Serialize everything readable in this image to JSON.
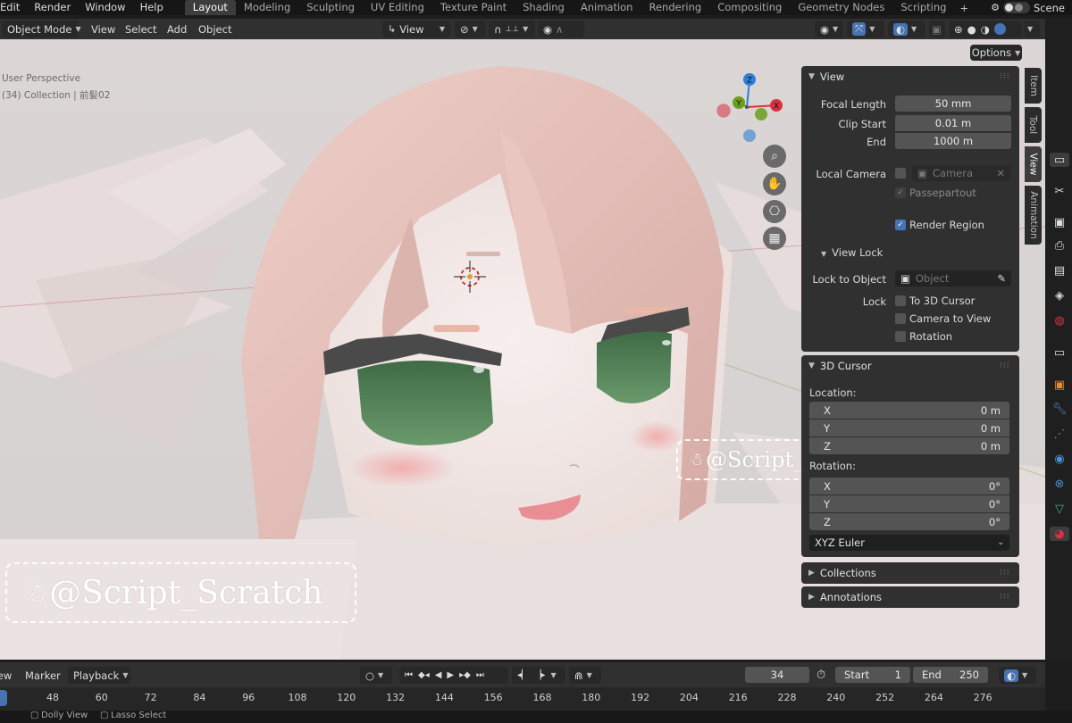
{
  "top_menu": [
    "Edit",
    "Render",
    "Window",
    "Help"
  ],
  "workspaces": [
    {
      "label": "Layout",
      "active": true
    },
    {
      "label": "Modeling",
      "active": false
    },
    {
      "label": "Sculpting",
      "active": false
    },
    {
      "label": "UV Editing",
      "active": false
    },
    {
      "label": "Texture Paint",
      "active": false
    },
    {
      "label": "Shading",
      "active": false
    },
    {
      "label": "Animation",
      "active": false
    },
    {
      "label": "Rendering",
      "active": false
    },
    {
      "label": "Compositing",
      "active": false
    },
    {
      "label": "Geometry Nodes",
      "active": false
    },
    {
      "label": "Scripting",
      "active": false
    }
  ],
  "add_workspace": "+",
  "scene_name": "Scene",
  "header": {
    "mode": "Object Mode",
    "menus": [
      "View",
      "Select",
      "Add",
      "Object"
    ],
    "transform_orientation": "View"
  },
  "viewport": {
    "perspective_label": "User Perspective",
    "collection_label": "(34) Collection | 前髪02",
    "options_label": "Options",
    "axes": {
      "x": "X",
      "y": "Y",
      "z": "Z"
    }
  },
  "watermarks": [
    "@Script_Scratch",
    "@Script_Scratch"
  ],
  "sidebar_tabs": [
    "Item",
    "Tool",
    "View",
    "Animation"
  ],
  "active_sidebar_tab": "View",
  "view_panel": {
    "title": "View",
    "focal_length_label": "Focal Length",
    "focal_length": "50 mm",
    "clip_start_label": "Clip Start",
    "clip_start": "0.01 m",
    "clip_end_label": "End",
    "clip_end": "1000 m",
    "local_camera_label": "Local Camera",
    "local_camera_placeholder": "Camera",
    "passepartout_label": "Passepartout",
    "render_region_label": "Render Region",
    "render_region_checked": true,
    "view_lock_title": "View Lock",
    "lock_to_object_label": "Lock to Object",
    "lock_to_object_placeholder": "Object",
    "lock_label": "Lock",
    "lock_options": [
      "To 3D Cursor",
      "Camera to View",
      "Rotation"
    ]
  },
  "cursor_panel": {
    "title": "3D Cursor",
    "location_label": "Location:",
    "location": [
      {
        "axis": "X",
        "value": "0 m"
      },
      {
        "axis": "Y",
        "value": "0 m"
      },
      {
        "axis": "Z",
        "value": "0 m"
      }
    ],
    "rotation_label": "Rotation:",
    "rotation": [
      {
        "axis": "X",
        "value": "0°"
      },
      {
        "axis": "Y",
        "value": "0°"
      },
      {
        "axis": "Z",
        "value": "0°"
      }
    ],
    "rotation_mode": "XYZ Euler"
  },
  "collections_title": "Collections",
  "annotations_title": "Annotations",
  "timeline": {
    "menus": [
      "View",
      "Marker",
      "Playback"
    ],
    "current_frame": "34",
    "start_label": "Start",
    "start": "1",
    "end_label": "End",
    "end": "250",
    "ticks": [
      "48",
      "60",
      "72",
      "84",
      "96",
      "108",
      "120",
      "132",
      "144",
      "156",
      "168",
      "180",
      "192",
      "204",
      "216",
      "228",
      "240",
      "252",
      "264",
      "276"
    ]
  },
  "status_bar": [
    "Dolly View",
    "Lasso Select"
  ],
  "colors": {
    "accent_blue": "#4772b3",
    "axis_x": "#d6323f",
    "axis_y": "#6c9d1f",
    "axis_z": "#2e7fd6",
    "panel_bg": "#303030"
  }
}
